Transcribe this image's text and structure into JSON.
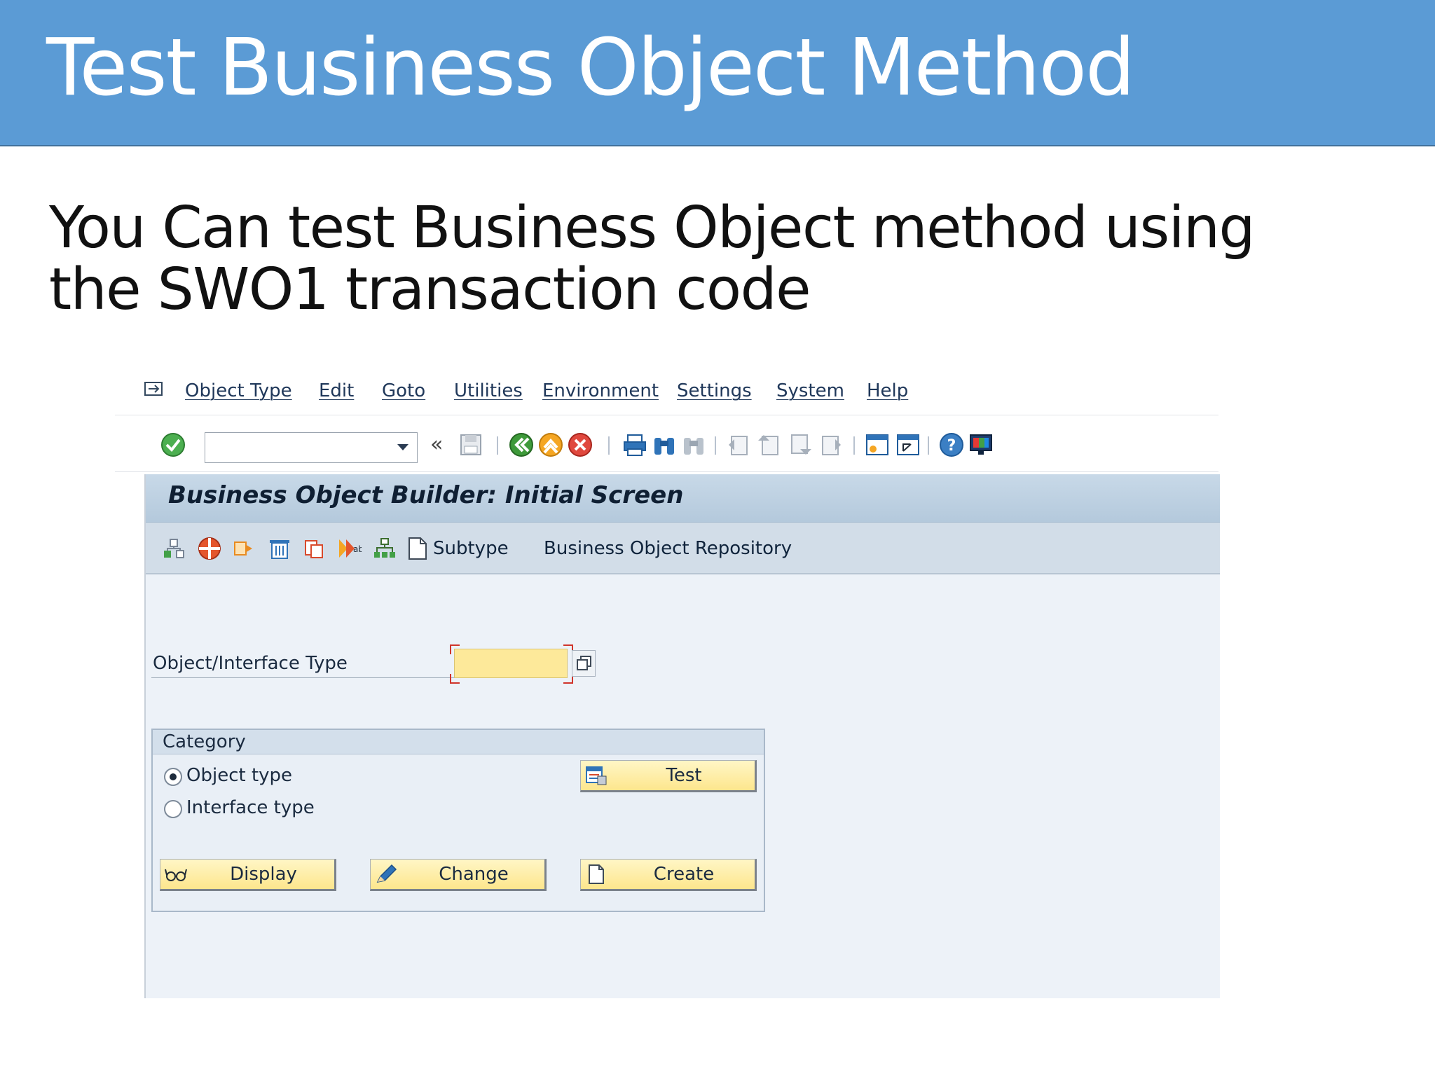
{
  "slide": {
    "title": "Test Business Object Method",
    "subtitle": "You Can test Business Object method using the SWO1 transaction code",
    "header_color": "#5b9bd5"
  },
  "menu": {
    "items": [
      "Object Type",
      "Edit",
      "Goto",
      "Utilities",
      "Environment",
      "Settings",
      "System",
      "Help"
    ]
  },
  "toolbar": {
    "command_field_value": "",
    "icons": [
      "enter-icon",
      "back-icon",
      "exit-icon",
      "cancel-icon",
      "print-icon",
      "find-icon",
      "find-next-icon",
      "first-page-icon",
      "previous-page-icon",
      "next-page-icon",
      "last-page-icon",
      "new-session-icon",
      "shortcut-icon",
      "help-icon",
      "layout-icon"
    ]
  },
  "screen": {
    "title": "Business Object Builder: Initial Screen",
    "app_toolbar": {
      "subtype_label": "Subtype",
      "repository_label": "Business Object Repository"
    },
    "field": {
      "label": "Object/Interface Type",
      "value": ""
    },
    "category": {
      "title": "Category",
      "options": [
        {
          "label": "Object type",
          "checked": true
        },
        {
          "label": "Interface type",
          "checked": false
        }
      ]
    },
    "buttons": {
      "test": "Test",
      "display": "Display",
      "change": "Change",
      "create": "Create"
    },
    "colors": {
      "input_required": "#fde99a",
      "button_yellow": "#fde68d",
      "screen_background": "#edf2f8"
    }
  }
}
